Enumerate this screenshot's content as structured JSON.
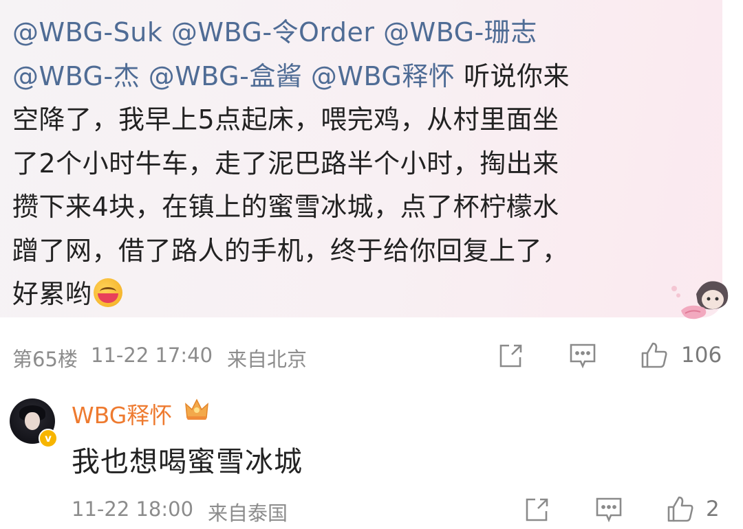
{
  "post": {
    "lines": [
      [
        "@WBG-Suk @WBG-令Order @WBG-珊志",
        ""
      ],
      [
        "@WBG-杰 @WBG-盒酱 @WBG释怀",
        " 听说你来"
      ],
      [
        "",
        "空降了，我早上5点起床，喂完鸡，从村里面坐"
      ],
      [
        "",
        "了2个小时牛车，走了泥巴路半个小时，掏出来"
      ],
      [
        "",
        "攒下来4块，在镇上的蜜雪冰城，点了杯柠檬水"
      ],
      [
        "",
        "蹭了网，借了路人的手机，终于给你回复上了，"
      ],
      [
        "",
        "好累哟"
      ]
    ],
    "emoji": "hearts-kiss-emoji",
    "floor": "第65楼",
    "time": "11-22 17:40",
    "location": "来自北京",
    "like_count": "106"
  },
  "reply": {
    "username": "WBG释怀",
    "text": "我也想喝蜜雪冰城",
    "time": "11-22 18:00",
    "location": "来自泰国",
    "like_count": "2"
  },
  "colors": {
    "mention": "#4f6c95",
    "username": "#ee7a2f",
    "meta": "#8c8c8c",
    "bubble_bg": "#f7f1f4"
  }
}
